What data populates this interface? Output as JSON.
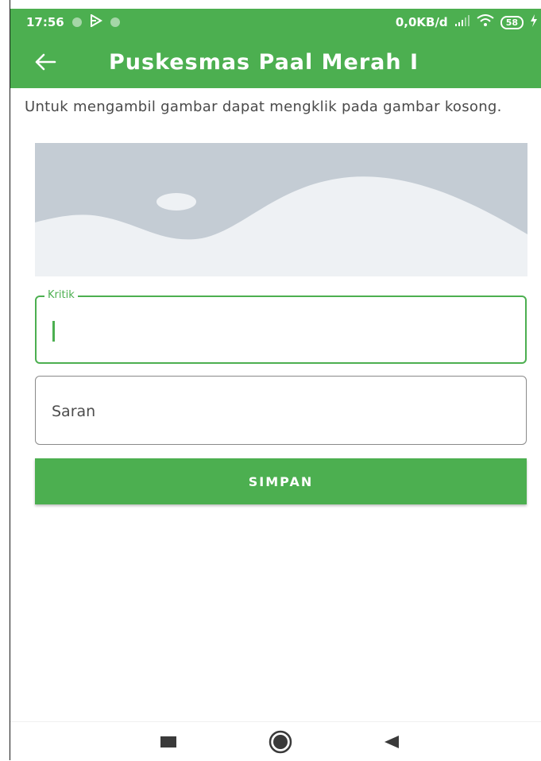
{
  "status_bar": {
    "time": "17:56",
    "network_speed": "0,0KB/d",
    "battery_level": "58",
    "icons": [
      "notification-dot-icon",
      "play-store-icon",
      "notification-dot-icon",
      "signal-icon",
      "wifi-icon",
      "battery-icon",
      "charging-icon"
    ]
  },
  "app_bar": {
    "title": "Puskesmas Paal Merah I",
    "back_icon": "arrow-left-icon"
  },
  "content": {
    "hint": "Untuk mengambil gambar dapat mengklik pada gambar kosong.",
    "image_placeholder_icon": "image-placeholder-icon",
    "fields": {
      "kritik": {
        "label": "Kritik",
        "value": ""
      },
      "saran": {
        "placeholder": "Saran",
        "value": ""
      }
    },
    "save_label": "SIMPAN"
  },
  "nav_bar": {
    "icons": [
      "recent-apps-icon",
      "home-icon",
      "back-triangle-icon"
    ]
  },
  "colors": {
    "primary": "#4caf50",
    "placeholder_bg": "#c4ccd4",
    "placeholder_fg": "#eef1f4"
  }
}
